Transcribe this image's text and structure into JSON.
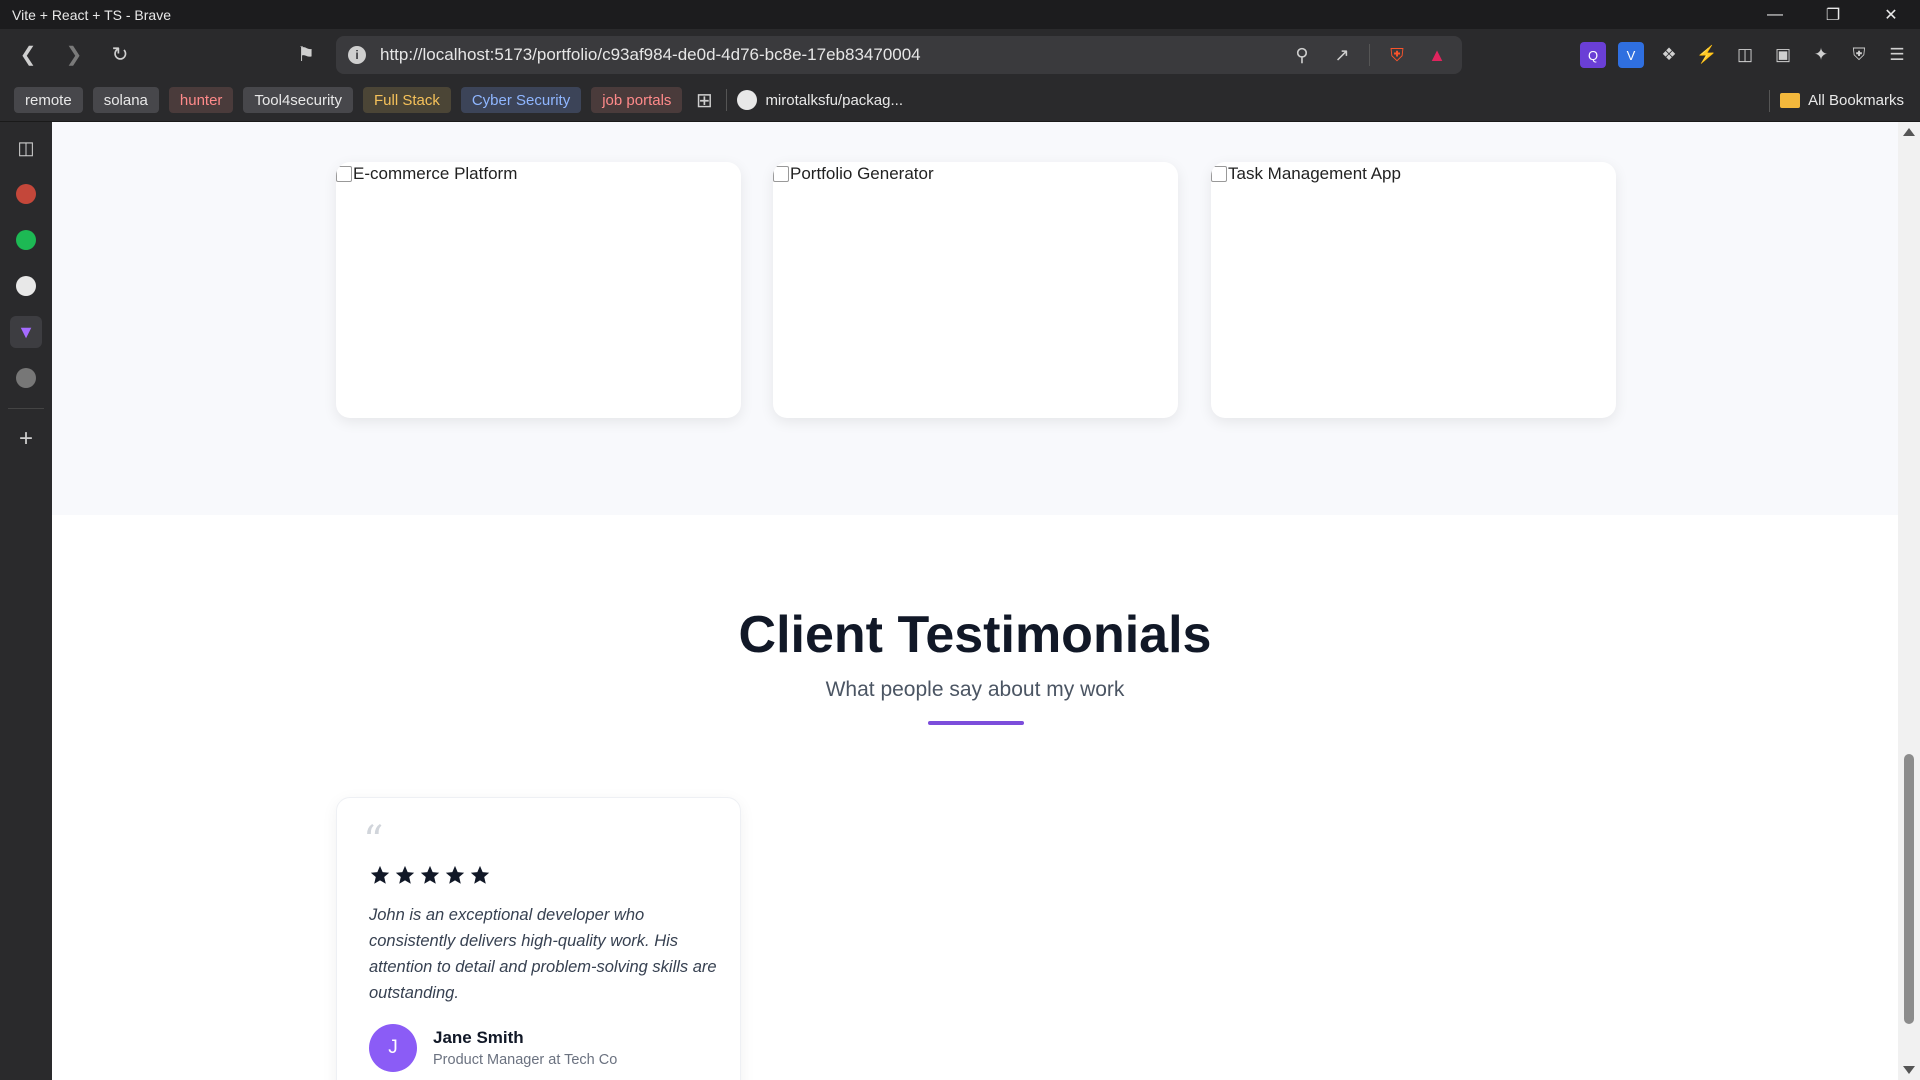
{
  "window": {
    "title": "Vite + React + TS - Brave"
  },
  "toolbar": {
    "url": "http://localhost:5173/portfolio/c93af984-de0d-4d76-bc8e-17eb83470004"
  },
  "bookmarks": {
    "items": [
      {
        "label": "remote",
        "style": "gray"
      },
      {
        "label": "solana",
        "style": "gray"
      },
      {
        "label": "hunter",
        "style": "red"
      },
      {
        "label": "Tool4security",
        "style": "gray"
      },
      {
        "label": "Full Stack",
        "style": "yellow"
      },
      {
        "label": "Cyber Security",
        "style": "blue"
      },
      {
        "label": "job portals",
        "style": "red"
      }
    ],
    "github_link": "mirotalksfu/packag...",
    "all_bookmarks": "All Bookmarks"
  },
  "projects": {
    "cards": [
      {
        "alt": "E-commerce Platform"
      },
      {
        "alt": "Portfolio Generator"
      },
      {
        "alt": "Task Management App"
      }
    ]
  },
  "testimonials": {
    "title": "Client Testimonials",
    "subtitle": "What people say about my work",
    "accent_color": "#7c4ddb",
    "items": [
      {
        "rating": 5,
        "quote": "John is an exceptional developer who consistently delivers high-quality work. His attention to detail and problem-solving skills are outstanding.",
        "avatar_initial": "J",
        "name": "Jane Smith",
        "role": "Product Manager at Tech Co"
      }
    ]
  }
}
